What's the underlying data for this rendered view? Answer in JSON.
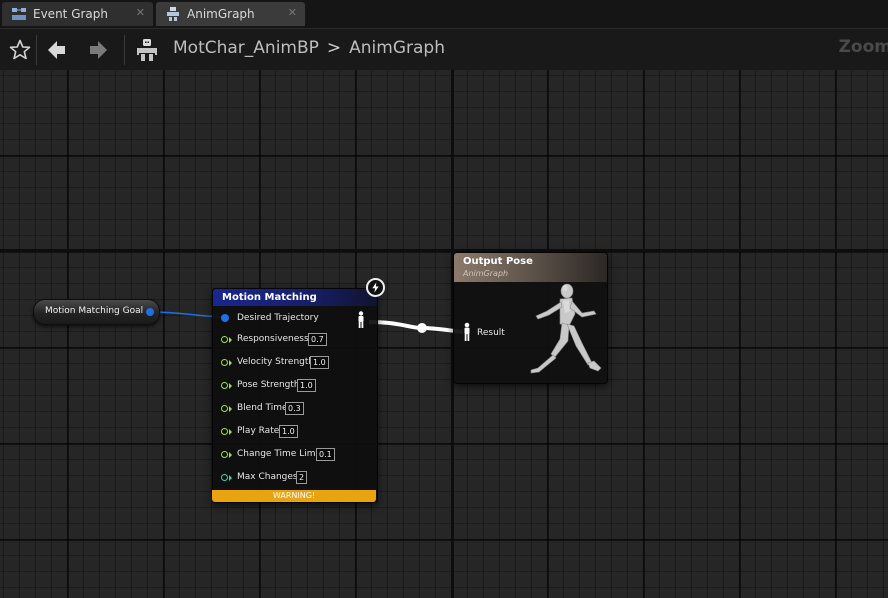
{
  "tabs": [
    {
      "label": "Event Graph",
      "icon": "event-graph-icon",
      "close": "✕",
      "active": false
    },
    {
      "label": "AnimGraph",
      "icon": "anim-graph-icon",
      "close": "✕",
      "active": true
    }
  ],
  "toolbar": {
    "favorite_icon": "star-icon",
    "back_icon": "arrow-left-icon",
    "forward_icon": "arrow-right-icon",
    "asset_icon": "skeleton-icon",
    "breadcrumb": {
      "asset": "MotChar_AnimBP",
      "separator": ">",
      "graph": "AnimGraph"
    },
    "zoom_label": "Zoom"
  },
  "graph": {
    "goal_node": {
      "label": "Motion Matching Goal",
      "pin_color": "#1f6fe6"
    },
    "motion_matching_node": {
      "title": "Motion Matching",
      "header_color": "#1a2691",
      "badge_icon": "lightning-icon",
      "output_pin_icon": "pose-pin-icon",
      "pins": [
        {
          "label": "Desired Trajectory",
          "type": "struct"
        },
        {
          "label": "Responsiveness",
          "type": "float",
          "value": "0.7"
        },
        {
          "label": "Velocity Strength",
          "type": "float",
          "value": "1.0"
        },
        {
          "label": "Pose Strength",
          "type": "float",
          "value": "1.0"
        },
        {
          "label": "Blend Time",
          "type": "float",
          "value": "0.3"
        },
        {
          "label": "Play Rate",
          "type": "float",
          "value": "1.0"
        },
        {
          "label": "Change Time Limit",
          "type": "float",
          "value": "0.1"
        },
        {
          "label": "Max Changes",
          "type": "int",
          "value": "2"
        }
      ],
      "warning": "WARNING!",
      "warning_color": "#e8a30f"
    },
    "output_pose_node": {
      "title": "Output Pose",
      "subtitle": "AnimGraph",
      "header_color": "#8b7b6d",
      "result_label": "Result",
      "input_pin_icon": "pose-pin-icon",
      "figure_icon": "running-mannequin-icon"
    },
    "colors": {
      "float_pin": "#9ae23a",
      "int_pin": "#2fd4b3",
      "struct_pin": "#1f6fe6",
      "pose_wire": "#ffffff",
      "struct_wire": "#1f6fe6"
    }
  }
}
